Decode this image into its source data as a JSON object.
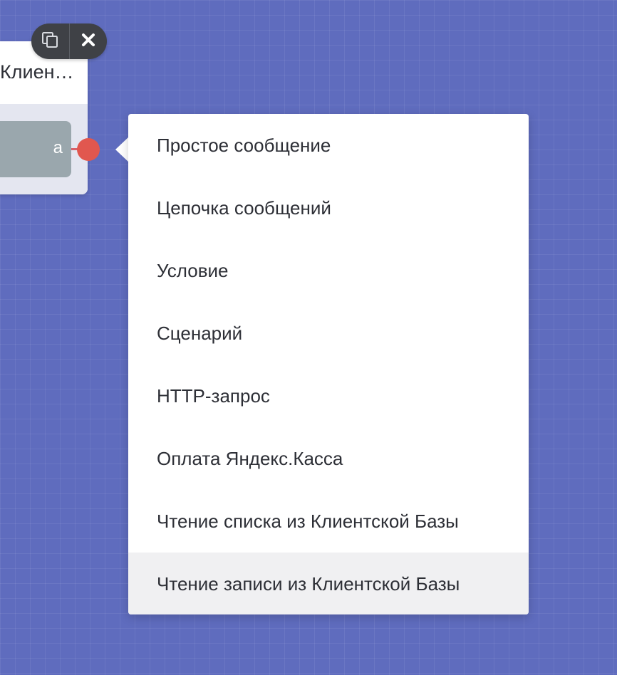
{
  "node": {
    "title": "Клиен…",
    "button_label": "а"
  },
  "toolbar": {
    "copy_icon": "copy-icon",
    "close_icon": "close-icon"
  },
  "menu": {
    "items": [
      {
        "label": "Простое сообщение"
      },
      {
        "label": "Цепочка сообщений"
      },
      {
        "label": "Условие"
      },
      {
        "label": "Сценарий"
      },
      {
        "label": "HTTP-запрос"
      },
      {
        "label": "Оплата Яндекс.Касса"
      },
      {
        "label": "Чтение списка из Клиентской Базы"
      },
      {
        "label": "Чтение записи из Клиентской Базы"
      }
    ],
    "hovered_index": 7
  },
  "colors": {
    "canvas_background": "#5f6cbe",
    "connector": "#e1574f",
    "toolbar": "#3f4146",
    "node_button": "#9aa7ad"
  }
}
